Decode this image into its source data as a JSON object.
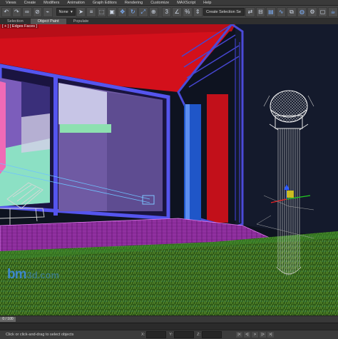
{
  "menu": [
    "Views",
    "Create",
    "Modifiers",
    "Animation",
    "Graph Editors",
    "Rendering",
    "Customize",
    "MAXScript",
    "Help"
  ],
  "toolbar": {
    "selection_filter": "None",
    "named_selection_placeholder": "Create Selection Se",
    "icons": [
      "undo-icon",
      "redo-icon",
      "link-icon",
      "unlink-icon",
      "bind-icon",
      "filter-icon",
      "select-icon",
      "select-by-name-icon",
      "rect-region-icon",
      "window-crossing-icon",
      "move-icon",
      "rotate-icon",
      "scale-icon",
      "pivot-icon",
      "snap-icon",
      "angle-snap-icon",
      "percent-snap-icon",
      "spinner-snap-icon",
      "mirror-icon",
      "align-icon",
      "layer-icon",
      "curve-editor-icon",
      "schematic-icon",
      "material-editor-icon",
      "render-setup-icon",
      "render-frame-icon",
      "render-icon"
    ]
  },
  "ribbon_tabs": [
    "Selection",
    "Object Paint",
    "Populate"
  ],
  "active_ribbon_tab": "Object Paint",
  "viewport_label": "[ + ] [ Edges Faces ]",
  "watermark": {
    "logo": "bm",
    "rest": "3d.com"
  },
  "timeslider": {
    "label": "0 / 100"
  },
  "status": {
    "text": "Click or click-and-drag to select objects",
    "coords": [
      "X:",
      "Y:",
      "Z:"
    ]
  },
  "playback": [
    "|<",
    "<|",
    ">",
    "|>",
    ">|"
  ],
  "colors": {
    "wall_red": "#d3101b",
    "frame_blue": "#5555ee",
    "grass_green": "#3f7a1f",
    "floor_magenta": "#a52db8",
    "night_sky": "#101520"
  }
}
